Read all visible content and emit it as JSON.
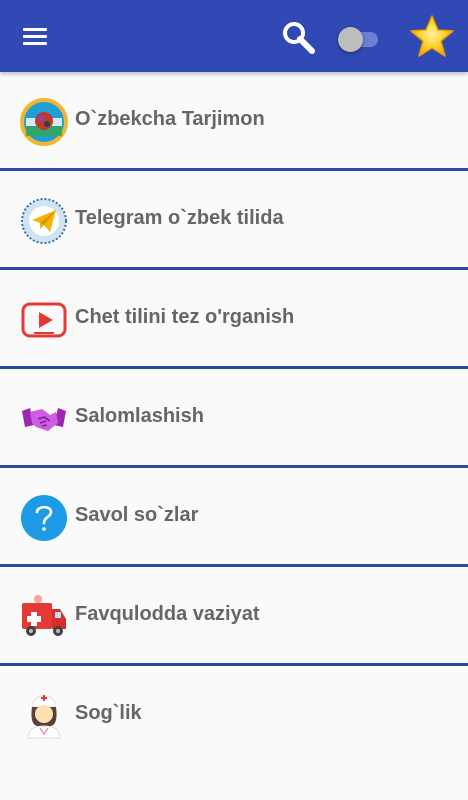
{
  "appbar": {
    "background": "#3049b4",
    "menu_icon": "hamburger-menu-icon",
    "search_icon": "magnifier-icon",
    "toggle_icon": "switch-toggle",
    "toggle_on": false,
    "star_icon": "star-icon"
  },
  "items": [
    {
      "label": "O`zbekcha Tarjimon",
      "icon": "flag-globe-icon"
    },
    {
      "label": "Telegram o`zbek tilida",
      "icon": "telegram-plane-icon"
    },
    {
      "label": "Chet tilini tez o'rganish",
      "icon": "youtube-play-icon"
    },
    {
      "label": "Salomlashish",
      "icon": "handshake-icon"
    },
    {
      "label": "Savol so`zlar",
      "icon": "question-mark-icon"
    },
    {
      "label": "Favqulodda vaziyat",
      "icon": "ambulance-icon"
    },
    {
      "label": "Sog`lik",
      "icon": "nurse-icon"
    }
  ],
  "colors": {
    "divider": "#2c4aa0",
    "label": "#666666"
  }
}
